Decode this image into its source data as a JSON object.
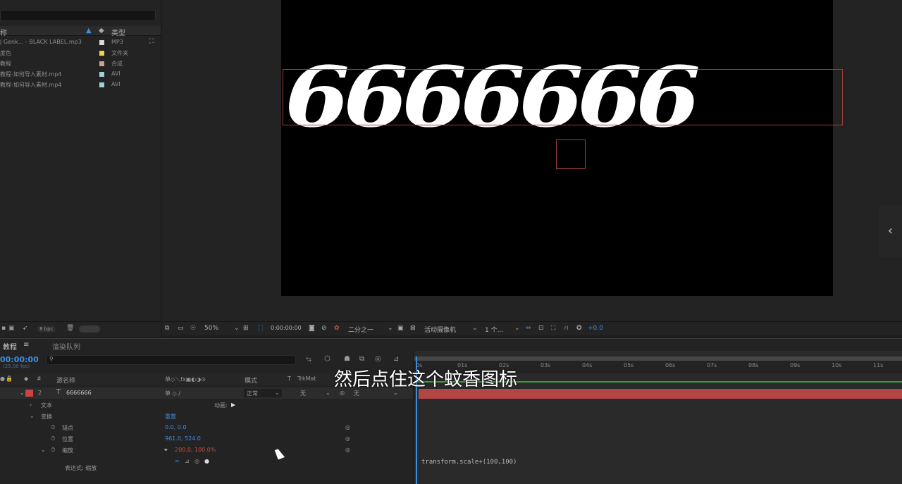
{
  "project": {
    "header_name": "称",
    "header_type": "类型",
    "rows": [
      {
        "name": "J Genk... - BLACK LABEL.mp3",
        "type": "MP3",
        "color": "#d9d9d9"
      },
      {
        "name": "度色",
        "type": "文件夹",
        "color": "#e8d44d"
      },
      {
        "name": "教程",
        "type": "合成",
        "color": "#c9a68e"
      },
      {
        "name": "教程-如何导入素材.mp4",
        "type": "AVI",
        "color": "#9cd3d8"
      },
      {
        "name": "教程-如何导入素材.mp4",
        "type": "AVI",
        "color": "#9cd3d8"
      }
    ],
    "footer_bpc": "8 bpc"
  },
  "viewer": {
    "text_content": "6666666",
    "zoom": "50%",
    "timecode": "0:00:00:00",
    "resolution": "二分之一",
    "camera": "活动摄像机",
    "views": "1 个...",
    "exposure": "+0.0"
  },
  "timeline": {
    "tab_comp": "教程",
    "tab_render": "渲染队列",
    "timecode": "00:00:00",
    "fps": "(25.00 fps)",
    "col_source": "源名称",
    "col_mode": "模式",
    "col_t": "T",
    "col_trkmat": "TrkMat",
    "layer": {
      "index": "2",
      "name": "6666666",
      "mode": "正常",
      "trkmat": "无",
      "parent": "无"
    },
    "props": {
      "text": "文本",
      "animate": "动画:",
      "transform": "变换",
      "reset": "重置",
      "anchor_label": "锚点",
      "anchor_value": "0.0, 0.0",
      "position_label": "位置",
      "position_value": "961.0, 524.0",
      "scale_label": "缩放",
      "scale_value": "200.0, 100.0%",
      "expression_label": "表达式: 缩放"
    },
    "ruler_labels": [
      "0s",
      "01s",
      "02s",
      "03s",
      "04s",
      "05s",
      "06s",
      "07s",
      "08s",
      "09s",
      "10s",
      "11s"
    ],
    "expression_text": "transform.scale+(100,100)"
  },
  "subtitle": "然后点住这个蚊香图标"
}
